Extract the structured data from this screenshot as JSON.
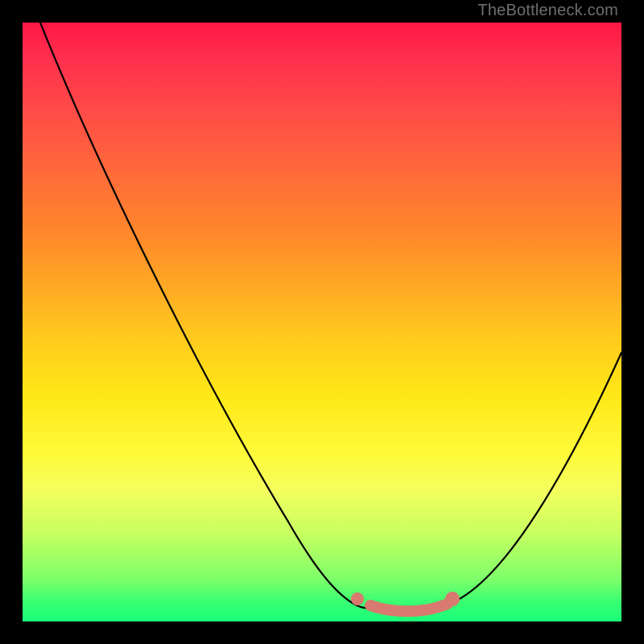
{
  "attribution": "TheBottleneck.com",
  "colors": {
    "curve": "#000000",
    "accent": "#d87a6f",
    "gradient_top": "#ff1744",
    "gradient_mid": "#ffe716",
    "gradient_bottom": "#1aff78",
    "page_bg": "#000000"
  },
  "chart_data": {
    "type": "line",
    "title": "",
    "xlabel": "",
    "ylabel": "",
    "xlim": [
      0,
      100
    ],
    "ylim": [
      0,
      100
    ],
    "series": [
      {
        "name": "bottleneck-curve",
        "x": [
          3,
          10,
          17,
          24,
          31,
          38,
          45,
          52,
          56,
          60,
          64,
          68,
          72,
          78,
          84,
          90,
          96,
          100
        ],
        "y": [
          100,
          88,
          77,
          65,
          54,
          42,
          30,
          18,
          11,
          6,
          3,
          2,
          3,
          7,
          14,
          24,
          36,
          45
        ]
      }
    ],
    "highlight": {
      "name": "sweet-spot",
      "x_range": [
        55,
        72
      ],
      "y_approx": 2,
      "color": "#d87a6f"
    },
    "background_gradient": [
      "#ff1744",
      "#ffe716",
      "#1aff78"
    ],
    "grid": false,
    "legend": false
  }
}
